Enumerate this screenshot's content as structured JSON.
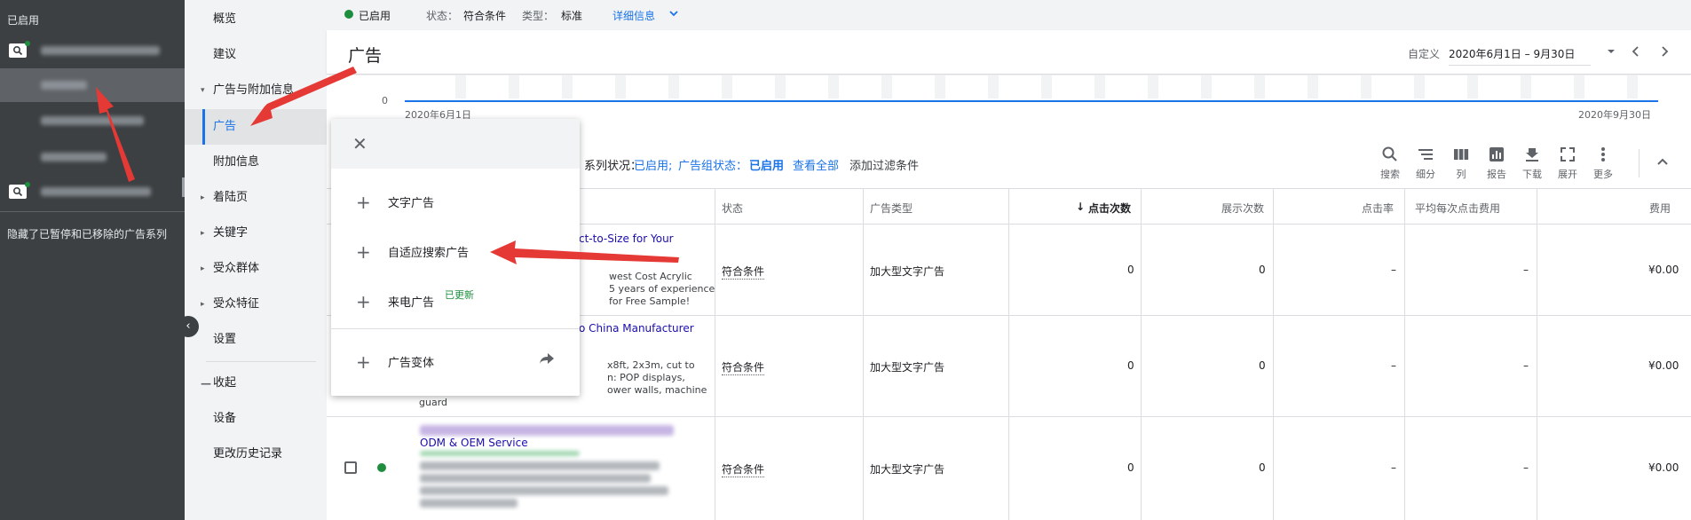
{
  "account_panel": {
    "status": "已启用",
    "hidden_note": "隐藏了已暂停和已移除的广告系列"
  },
  "nav": {
    "items": [
      {
        "label": "概览",
        "caret": ""
      },
      {
        "label": "建议",
        "caret": ""
      },
      {
        "label": "广告与附加信息",
        "caret": "▾"
      },
      {
        "label": "广告",
        "caret": ""
      },
      {
        "label": "附加信息",
        "caret": ""
      },
      {
        "label": "着陆页",
        "caret": "▸"
      },
      {
        "label": "关键字",
        "caret": "▸"
      },
      {
        "label": "受众群体",
        "caret": "▸"
      },
      {
        "label": "受众特征",
        "caret": "▸"
      },
      {
        "label": "设置",
        "caret": ""
      }
    ],
    "collapse_label": "收起",
    "collapse_symbol": "—",
    "bottom_items": [
      "设备",
      "更改历史记录"
    ]
  },
  "status_bar": {
    "state": "已启用",
    "status_label": "状态：",
    "status_value": "符合条件",
    "type_label": "类型：",
    "type_value": "标准",
    "details_link": "详细信息"
  },
  "header": {
    "title": "广告",
    "date_custom": "自定义",
    "date_range": "2020年6月1日 – 9月30日"
  },
  "chart": {
    "y_zero": "0",
    "x_start": "2020年6月1日",
    "x_end": "2020年9月30日"
  },
  "filter": {
    "campaign_status_label": "系列状况：",
    "campaign_status_value": "已启用;",
    "adgroup_status_label": "广告组状态：",
    "adgroup_status_value": "已启用",
    "view_all": "查看全部",
    "add_filter": "添加过滤条件"
  },
  "toolbar": {
    "tools": [
      {
        "label": "搜索",
        "icon": "search-icon"
      },
      {
        "label": "细分",
        "icon": "segment-icon"
      },
      {
        "label": "列",
        "icon": "columns-icon"
      },
      {
        "label": "报告",
        "icon": "report-icon"
      },
      {
        "label": "下载",
        "icon": "download-icon"
      },
      {
        "label": "展开",
        "icon": "expand-icon"
      },
      {
        "label": "更多",
        "icon": "more-icon"
      }
    ]
  },
  "table": {
    "headers": [
      "状态",
      "广告类型",
      "点击次数",
      "展示次数",
      "点击率",
      "平均每次点击费用",
      "费用"
    ],
    "rows": [
      {
        "ad_headline": "ct-to-Size for Your",
        "ad_lines": [
          "west Cost Acrylic",
          "5 years of experience",
          "for Free Sample!"
        ],
        "status": "符合条件",
        "type": "加大型文字广告",
        "clicks": "0",
        "impr": "0",
        "ctr": "–",
        "cpc": "–",
        "cost": "¥0.00"
      },
      {
        "ad_headline": "o China Manufacturer",
        "ad_lines": [
          "x8ft, 2x3m, cut to",
          "n: POP displays,",
          "ower walls, machine",
          "guard"
        ],
        "status": "符合条件",
        "type": "加大型文字广告",
        "clicks": "0",
        "impr": "0",
        "ctr": "–",
        "cpc": "–",
        "cost": "¥0.00"
      },
      {
        "ad_headline": "ODM & OEM Service",
        "ad_lines": [],
        "status": "符合条件",
        "type": "加大型文字广告",
        "clicks": "0",
        "impr": "0",
        "ctr": "–",
        "cpc": "–",
        "cost": "¥0.00"
      }
    ]
  },
  "menu": {
    "items": [
      {
        "label": "文字广告",
        "badge": ""
      },
      {
        "label": "自适应搜索广告",
        "badge": ""
      },
      {
        "label": "来电广告",
        "badge": "已更新"
      }
    ],
    "variant_label": "广告变体"
  },
  "colors": {
    "accent": "#1a73e8",
    "enabled": "#1e8e3e",
    "annotation_arrow": "#e53935",
    "dark_panel": "#3c4043"
  }
}
